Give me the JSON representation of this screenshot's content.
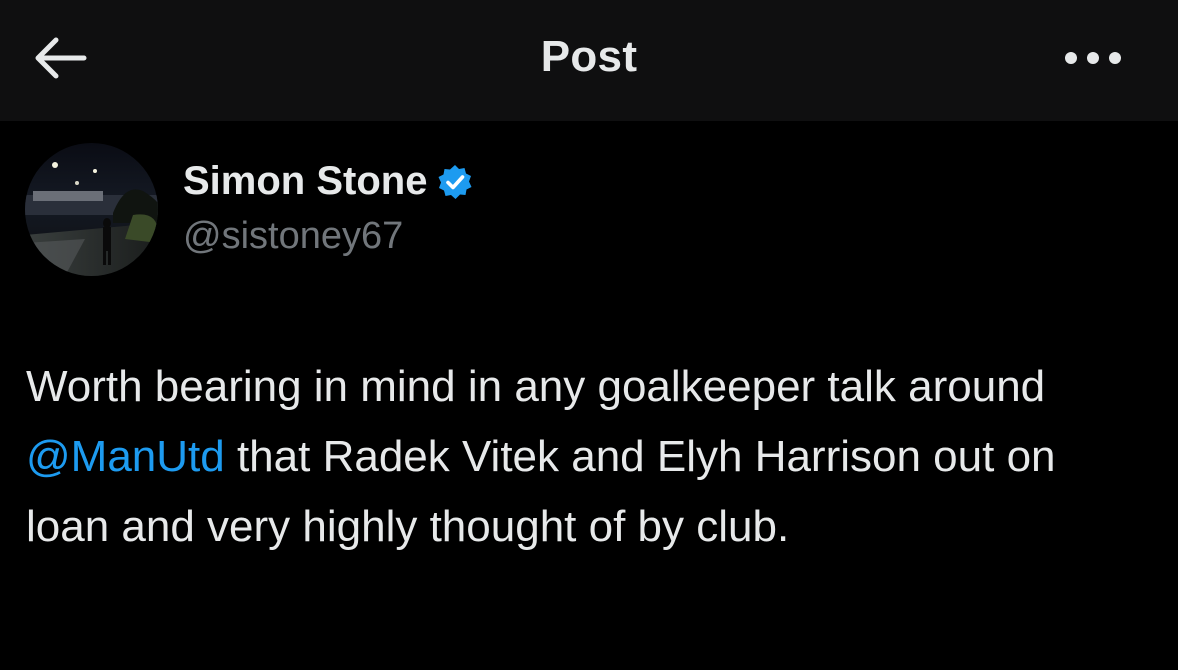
{
  "header": {
    "title": "Post",
    "back_icon": "arrow-left-icon",
    "more_icon": "more-horizontal-icon"
  },
  "author": {
    "name": "Simon Stone",
    "handle": "@sistoney67",
    "verified": true,
    "verified_color": "#1d9bf0"
  },
  "tweet": {
    "text_part1": "Worth bearing in mind in any goalkeeper talk around ",
    "mention": "@ManUtd",
    "text_part2": " that Radek Vitek and Elyh Harrison out on loan and very highly thought of by club."
  },
  "colors": {
    "background": "#000000",
    "header_background": "#0f0f10",
    "text": "#e7e9ea",
    "secondary_text": "#71767b",
    "accent": "#1d9bf0"
  }
}
